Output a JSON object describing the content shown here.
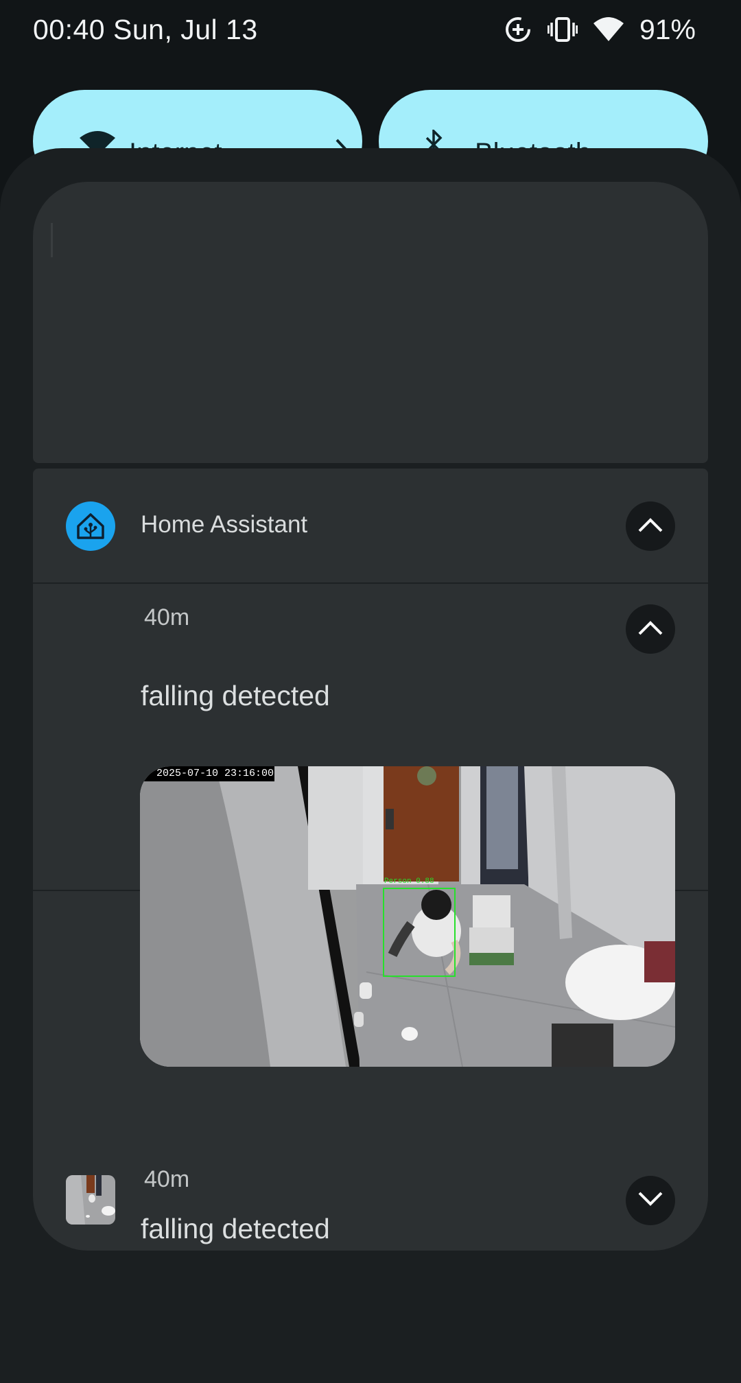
{
  "status_bar": {
    "time": "00:40",
    "date": "Sun, Jul 13",
    "icons": [
      "data-saver-icon",
      "vibrate-icon",
      "wifi-icon"
    ],
    "battery": "91%"
  },
  "quick_settings": {
    "tiles": [
      {
        "label": "Internet",
        "icon": "wifi-icon"
      },
      {
        "label": "Bluetooth",
        "icon": "bluetooth-icon"
      }
    ],
    "tile_color": "#a4eefb"
  },
  "notification": {
    "app_name": "Home Assistant",
    "app_icon_color": "#1aa3ee",
    "messages": [
      {
        "time": "40m",
        "title": "falling detected",
        "expanded": true,
        "image": {
          "timestamp": "2025-07-10 23:16:00",
          "detection_label": "Person 0.88"
        }
      },
      {
        "time": "40m",
        "title": "falling detected",
        "expanded": false
      }
    ]
  }
}
